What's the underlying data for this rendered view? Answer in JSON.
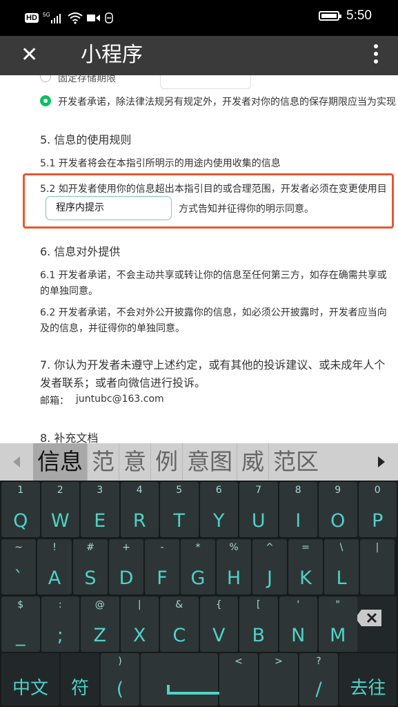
{
  "status_bar": {
    "hd": "HD",
    "network": "5G",
    "time": "5:50"
  },
  "app_bar": {
    "close": "✕",
    "title": "小程序"
  },
  "doc": {
    "cut_option": "固定存储期限",
    "promise": "开发者承诺，除法律法规另有规定外，开发者对你的信息的保存期限应当为实现",
    "sec5_title": "5.  信息的使用规则",
    "s51": "5.1   开发者将会在本指引所明示的用途内使用收集的信息",
    "s52_line1": "5.2   如开发者使用你的信息超出本指引目的或合理范围，开发者必须在变更使用目",
    "s52_input": "程序内提示",
    "s52_line2": "方式告知并征得你的明示同意。",
    "sec6_title": "6.  信息对外提供",
    "s61_line1": "6.1   开发者承诺，不会主动共享或转让你的信息至任何第三方，如存在确需共享或",
    "s61_line2": "的单独同意。",
    "s62_line1": "6.2   开发者承诺，不会对外公开披露你的信息，如必须公开披露时，开发者应当向",
    "s62_line2": "及的信息，并征得你的单独同意。",
    "sec7_line1": "7.  你认为开发者未遵守上述约定，或有其他的投诉建议、或未成年人个",
    "sec7_line2": "发者联系；或者向微信进行投诉。",
    "email_label": "邮箱：",
    "email": "juntubc@163.com",
    "sec8_title": "8.  补充文档"
  },
  "candidates": [
    "信息",
    "范",
    "意",
    "例",
    "意图",
    "威",
    "范区"
  ],
  "keyboard": {
    "row1": [
      {
        "top": "1",
        "main": "Q"
      },
      {
        "top": "2",
        "main": "W"
      },
      {
        "top": "3",
        "main": "E"
      },
      {
        "top": "4",
        "main": "R"
      },
      {
        "top": "5",
        "main": "T"
      },
      {
        "top": "6",
        "main": "Y"
      },
      {
        "top": "7",
        "main": "U"
      },
      {
        "top": "8",
        "main": "I"
      },
      {
        "top": "9",
        "main": "O"
      },
      {
        "top": "0",
        "main": "P"
      }
    ],
    "row2": [
      {
        "top": "~",
        "main": "`"
      },
      {
        "top": "!",
        "main": "A"
      },
      {
        "top": "#",
        "main": "S"
      },
      {
        "top": "+",
        "main": "D"
      },
      {
        "top": "-",
        "main": "F"
      },
      {
        "top": "*",
        "main": "G"
      },
      {
        "top": "%",
        "main": "H"
      },
      {
        "top": "^",
        "main": "J"
      },
      {
        "top": "=",
        "main": "K"
      },
      {
        "top": "\\",
        "main": "L"
      },
      {
        "top": "|",
        "main": ""
      }
    ],
    "row3": [
      {
        "top": "$",
        "main": "_"
      },
      {
        "top": ":",
        "main": ";"
      },
      {
        "top": "@",
        "main": "Z"
      },
      {
        "top": "|",
        "main": "X"
      },
      {
        "top": "&",
        "main": "C"
      },
      {
        "top": "{",
        "main": "V"
      },
      {
        "top": "[",
        "main": "B"
      },
      {
        "top": "'",
        "main": "N"
      },
      {
        "top": "\"",
        "main": "M"
      }
    ],
    "row4": {
      "lang": "中文",
      "sym": "符",
      "paren_top": ")",
      "paren": "(",
      "lt": "<",
      "gt": ">",
      "q": "?",
      "slash": "/",
      "go": "去往"
    }
  }
}
